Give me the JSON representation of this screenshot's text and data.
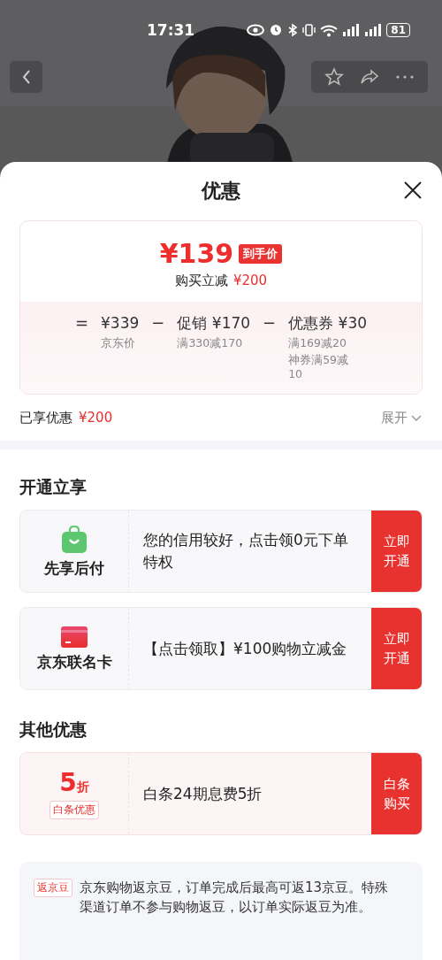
{
  "status_bar": {
    "time": "17:31",
    "battery": "81"
  },
  "sheet": {
    "title": "优惠"
  },
  "price_card": {
    "final_price": "¥139",
    "badge": "到手价",
    "saving_label": "购买立减",
    "saving_amount": "¥200",
    "breakdown": [
      {
        "operator": "=",
        "amount": "¥339",
        "notes": [
          "京东价"
        ]
      },
      {
        "operator": "−",
        "amount": "促销 ¥170",
        "notes": [
          "满330减170"
        ]
      },
      {
        "operator": "−",
        "amount": "优惠券 ¥30",
        "notes": [
          "满169减20",
          "神券满59减10"
        ]
      }
    ]
  },
  "summary": {
    "label": "已享优惠",
    "amount": "¥200",
    "toggle": "展开",
    "expanded": false
  },
  "sections": [
    {
      "title": "开通立享",
      "offers": [
        {
          "kind": "bag",
          "name": "先享后付",
          "text": "您的信用较好，点击领0元下单特权",
          "action": "立即开通"
        },
        {
          "kind": "card",
          "name": "京东联名卡",
          "text": "【点击领取】¥100购物立减金",
          "action": "立即开通"
        }
      ]
    },
    {
      "title": "其他优惠",
      "offers": [
        {
          "kind": "discount",
          "value": "5",
          "unit": "折",
          "tag": "白条优惠",
          "text": "白条24期息费5折",
          "action": "白条购买"
        }
      ]
    }
  ],
  "note": {
    "tag": "返京豆",
    "text": "京东购物返京豆，订单完成后最高可返13京豆。特殊渠道订单不参与购物返豆，以订单实际返豆为准。"
  }
}
